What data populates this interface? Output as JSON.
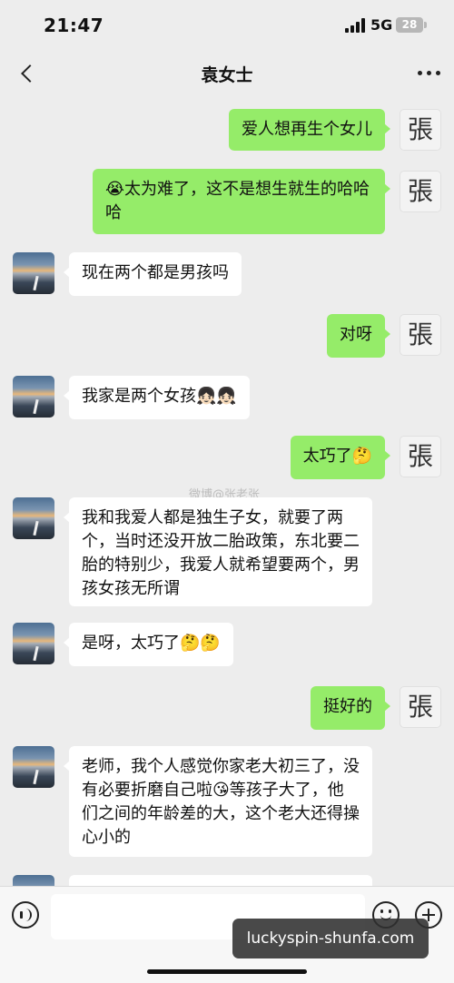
{
  "status": {
    "time": "21:47",
    "network": "5G",
    "battery": "28"
  },
  "nav": {
    "title": "袁女士"
  },
  "avatars": {
    "self_char": "張"
  },
  "messages": [
    {
      "from": "me",
      "text": "爱人想再生个女儿",
      "emoji": ""
    },
    {
      "from": "me",
      "lead_emoji": "😭",
      "text": "太为难了，这不是想生就生的哈哈哈"
    },
    {
      "from": "other",
      "text": "现在两个都是男孩吗",
      "emoji": ""
    },
    {
      "from": "me",
      "text": "对呀",
      "emoji": ""
    },
    {
      "from": "other",
      "text": "我家是两个女孩",
      "emoji": "👧🏻👧🏻"
    },
    {
      "from": "me",
      "text": "太巧了",
      "emoji": "🤔"
    },
    {
      "from": "other",
      "text": "我和我爱人都是独生子女，就要了两个，当时还没开放二胎政策，东北要二胎的特别少，我爱人就希望要两个，男孩女孩无所谓",
      "emoji": ""
    },
    {
      "from": "other",
      "text": "是呀，太巧了",
      "emoji": "🤔🤔"
    },
    {
      "from": "me",
      "text": "挺好的",
      "emoji": ""
    },
    {
      "from": "other",
      "text_before": "老师，我个人感觉你家老大初三了，没有必要折磨自己啦",
      "mid_emoji": "😘",
      "text_after": "等孩子大了，他们之间的年龄差的大，这个老大还得操心小的"
    }
  ],
  "watermark": "微博@张老张",
  "overlay": {
    "site": "luckyspin-shunfa.com"
  },
  "colors": {
    "outgoing": "#95ec69",
    "incoming": "#ffffff",
    "background": "#ededed"
  }
}
